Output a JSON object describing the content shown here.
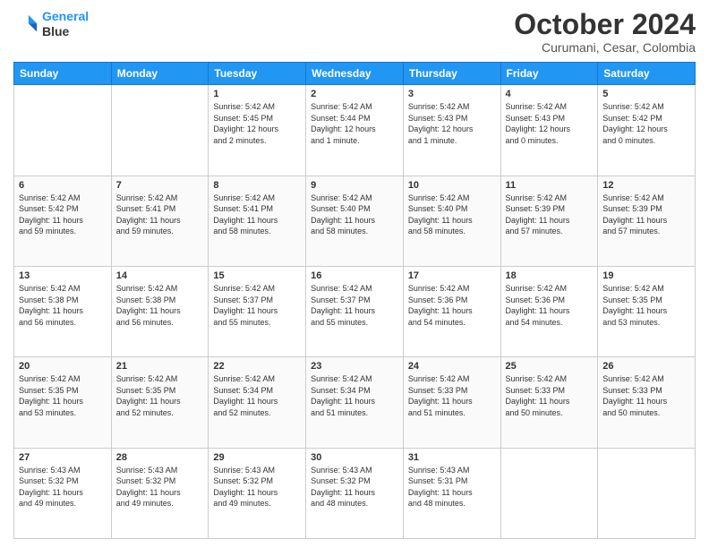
{
  "header": {
    "logo_line1": "General",
    "logo_line2": "Blue",
    "month_title": "October 2024",
    "location": "Curumani, Cesar, Colombia"
  },
  "weekdays": [
    "Sunday",
    "Monday",
    "Tuesday",
    "Wednesday",
    "Thursday",
    "Friday",
    "Saturday"
  ],
  "weeks": [
    [
      {
        "day": "",
        "info": ""
      },
      {
        "day": "",
        "info": ""
      },
      {
        "day": "1",
        "info": "Sunrise: 5:42 AM\nSunset: 5:45 PM\nDaylight: 12 hours\nand 2 minutes."
      },
      {
        "day": "2",
        "info": "Sunrise: 5:42 AM\nSunset: 5:44 PM\nDaylight: 12 hours\nand 1 minute."
      },
      {
        "day": "3",
        "info": "Sunrise: 5:42 AM\nSunset: 5:43 PM\nDaylight: 12 hours\nand 1 minute."
      },
      {
        "day": "4",
        "info": "Sunrise: 5:42 AM\nSunset: 5:43 PM\nDaylight: 12 hours\nand 0 minutes."
      },
      {
        "day": "5",
        "info": "Sunrise: 5:42 AM\nSunset: 5:42 PM\nDaylight: 12 hours\nand 0 minutes."
      }
    ],
    [
      {
        "day": "6",
        "info": "Sunrise: 5:42 AM\nSunset: 5:42 PM\nDaylight: 11 hours\nand 59 minutes."
      },
      {
        "day": "7",
        "info": "Sunrise: 5:42 AM\nSunset: 5:41 PM\nDaylight: 11 hours\nand 59 minutes."
      },
      {
        "day": "8",
        "info": "Sunrise: 5:42 AM\nSunset: 5:41 PM\nDaylight: 11 hours\nand 58 minutes."
      },
      {
        "day": "9",
        "info": "Sunrise: 5:42 AM\nSunset: 5:40 PM\nDaylight: 11 hours\nand 58 minutes."
      },
      {
        "day": "10",
        "info": "Sunrise: 5:42 AM\nSunset: 5:40 PM\nDaylight: 11 hours\nand 58 minutes."
      },
      {
        "day": "11",
        "info": "Sunrise: 5:42 AM\nSunset: 5:39 PM\nDaylight: 11 hours\nand 57 minutes."
      },
      {
        "day": "12",
        "info": "Sunrise: 5:42 AM\nSunset: 5:39 PM\nDaylight: 11 hours\nand 57 minutes."
      }
    ],
    [
      {
        "day": "13",
        "info": "Sunrise: 5:42 AM\nSunset: 5:38 PM\nDaylight: 11 hours\nand 56 minutes."
      },
      {
        "day": "14",
        "info": "Sunrise: 5:42 AM\nSunset: 5:38 PM\nDaylight: 11 hours\nand 56 minutes."
      },
      {
        "day": "15",
        "info": "Sunrise: 5:42 AM\nSunset: 5:37 PM\nDaylight: 11 hours\nand 55 minutes."
      },
      {
        "day": "16",
        "info": "Sunrise: 5:42 AM\nSunset: 5:37 PM\nDaylight: 11 hours\nand 55 minutes."
      },
      {
        "day": "17",
        "info": "Sunrise: 5:42 AM\nSunset: 5:36 PM\nDaylight: 11 hours\nand 54 minutes."
      },
      {
        "day": "18",
        "info": "Sunrise: 5:42 AM\nSunset: 5:36 PM\nDaylight: 11 hours\nand 54 minutes."
      },
      {
        "day": "19",
        "info": "Sunrise: 5:42 AM\nSunset: 5:35 PM\nDaylight: 11 hours\nand 53 minutes."
      }
    ],
    [
      {
        "day": "20",
        "info": "Sunrise: 5:42 AM\nSunset: 5:35 PM\nDaylight: 11 hours\nand 53 minutes."
      },
      {
        "day": "21",
        "info": "Sunrise: 5:42 AM\nSunset: 5:35 PM\nDaylight: 11 hours\nand 52 minutes."
      },
      {
        "day": "22",
        "info": "Sunrise: 5:42 AM\nSunset: 5:34 PM\nDaylight: 11 hours\nand 52 minutes."
      },
      {
        "day": "23",
        "info": "Sunrise: 5:42 AM\nSunset: 5:34 PM\nDaylight: 11 hours\nand 51 minutes."
      },
      {
        "day": "24",
        "info": "Sunrise: 5:42 AM\nSunset: 5:33 PM\nDaylight: 11 hours\nand 51 minutes."
      },
      {
        "day": "25",
        "info": "Sunrise: 5:42 AM\nSunset: 5:33 PM\nDaylight: 11 hours\nand 50 minutes."
      },
      {
        "day": "26",
        "info": "Sunrise: 5:42 AM\nSunset: 5:33 PM\nDaylight: 11 hours\nand 50 minutes."
      }
    ],
    [
      {
        "day": "27",
        "info": "Sunrise: 5:43 AM\nSunset: 5:32 PM\nDaylight: 11 hours\nand 49 minutes."
      },
      {
        "day": "28",
        "info": "Sunrise: 5:43 AM\nSunset: 5:32 PM\nDaylight: 11 hours\nand 49 minutes."
      },
      {
        "day": "29",
        "info": "Sunrise: 5:43 AM\nSunset: 5:32 PM\nDaylight: 11 hours\nand 49 minutes."
      },
      {
        "day": "30",
        "info": "Sunrise: 5:43 AM\nSunset: 5:32 PM\nDaylight: 11 hours\nand 48 minutes."
      },
      {
        "day": "31",
        "info": "Sunrise: 5:43 AM\nSunset: 5:31 PM\nDaylight: 11 hours\nand 48 minutes."
      },
      {
        "day": "",
        "info": ""
      },
      {
        "day": "",
        "info": ""
      }
    ]
  ]
}
